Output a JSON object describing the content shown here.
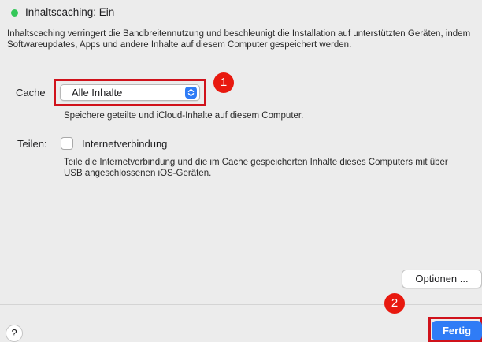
{
  "status": {
    "text": "Inhaltscaching: Ein",
    "indicator_color": "#34c759"
  },
  "description": "Inhaltscaching verringert die Bandbreitennutzung und beschleunigt die Installation auf unterstützten Geräten, indem Softwareupdates, Apps und andere Inhalte auf diesem Computer gespeichert werden.",
  "cache": {
    "label": "Cache",
    "selected_value": "Alle Inhalte",
    "subtext": "Speichere geteilte und iCloud-Inhalte auf diesem Computer."
  },
  "share": {
    "label": "Teilen:",
    "checkbox_label": "Internetverbindung",
    "checked": false,
    "subtext": "Teile die Internetverbindung und die im Cache gespeicherten Inhalte dieses Computers mit über USB angeschlossenen iOS-Geräten."
  },
  "buttons": {
    "options": "Optionen ...",
    "help": "?",
    "done": "Fertig"
  },
  "annotations": {
    "marker_1": "1",
    "marker_2": "2",
    "highlight_color": "#d0121b"
  },
  "colors": {
    "accent": "#2f7cf6",
    "marker": "#e8190f"
  }
}
